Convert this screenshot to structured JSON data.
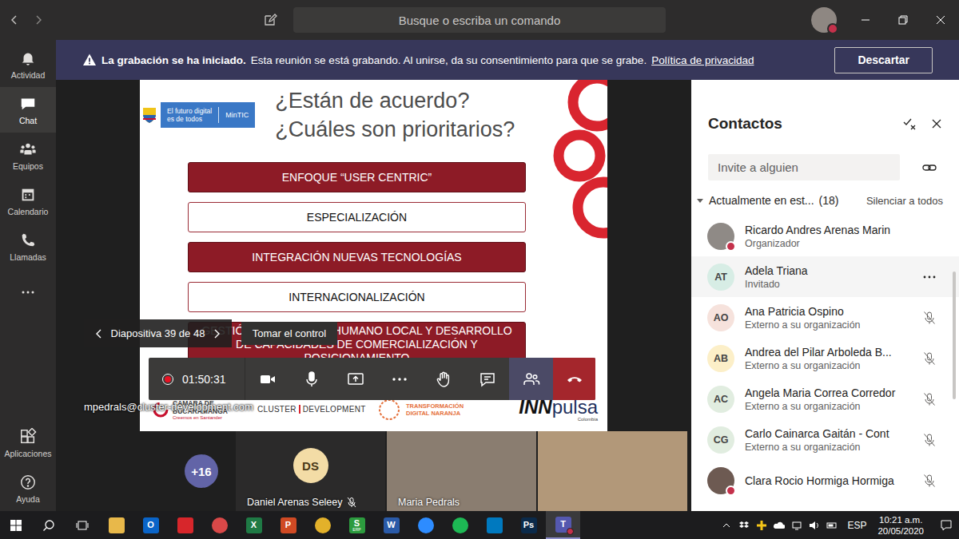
{
  "window": {
    "search_placeholder": "Busque o escriba un comando",
    "user_busy": true
  },
  "banner": {
    "title": "La grabación se ha iniciado.",
    "message": "Esta reunión se está grabando. Al unirse, da su consentimiento para que se grabe.",
    "link": "Política de privacidad",
    "button": "Descartar"
  },
  "rail": {
    "items": [
      {
        "label": "Actividad",
        "selected": false
      },
      {
        "label": "Chat",
        "selected": true
      },
      {
        "label": "Equipos",
        "selected": false
      },
      {
        "label": "Calendario",
        "selected": false
      },
      {
        "label": "Llamadas",
        "selected": false
      }
    ],
    "bottom_items": [
      {
        "label": "Aplicaciones",
        "selected": false
      },
      {
        "label": "Ayuda",
        "selected": false
      }
    ]
  },
  "slide": {
    "brand": {
      "line1": "El futuro digital",
      "line2": "es de todos",
      "name": "MinTIC"
    },
    "title_lines": [
      "¿Están de acuerdo?",
      "¿Cuáles son prioritarios?"
    ],
    "items": [
      {
        "text": "ENFOQUE “USER CENTRIC”",
        "kind": "filled"
      },
      {
        "text": "ESPECIALIZACIÓN",
        "kind": "outline"
      },
      {
        "text": "INTEGRACIÓN NUEVAS TECNOLOGÍAS",
        "kind": "filled"
      },
      {
        "text": "INTERNACIONALIZACIÓN",
        "kind": "outline"
      },
      {
        "text": "GESTIÓN DEL TALENTO HUMANO LOCAL Y DESARROLLO DE CAPACIDADES DE COMERCIALIZACIÓN Y POSICIONAMIENTO",
        "kind": "filled"
      }
    ],
    "footer": {
      "chamber_line1": "CAMARA DE",
      "chamber_line2": "BUCARAMANGA",
      "chamber_tagline": "Creemos en Santander",
      "cluster_left": "CLUSTER",
      "cluster_right": "DEVELOPMENT",
      "naranja_line1": "TRANSFORMACIÓN",
      "naranja_line2": "DIGITAL NARANJA",
      "inn": "INN",
      "pulsa": "pulsa",
      "inn_country": "Colombia"
    }
  },
  "presenter": {
    "email": "mpedrals@cluster-development.com",
    "slide_counter": "Diapositiva 39 de 48",
    "take_control": "Tomar el control"
  },
  "call_controls": {
    "recording": true,
    "timer": "01:50:31",
    "buttons": [
      {
        "kind": "camera",
        "selected": false
      },
      {
        "kind": "mic",
        "selected": false
      },
      {
        "kind": "share",
        "selected": false
      },
      {
        "kind": "more",
        "selected": false
      },
      {
        "kind": "hand",
        "selected": false
      },
      {
        "kind": "chat",
        "selected": false
      },
      {
        "kind": "participants",
        "selected": true
      },
      {
        "kind": "hangup",
        "selected": false
      }
    ]
  },
  "gallery": {
    "overflow": "+16",
    "tiles": [
      {
        "kind": "avatar",
        "initials": "DS",
        "name": "Daniel Arenas Seleey",
        "muted": true,
        "color": "#f3dca6"
      },
      {
        "kind": "video",
        "name": "Maria Pedrals",
        "muted": false,
        "color": "#8a7d70"
      },
      {
        "kind": "video",
        "muted": false,
        "color": "#b29879"
      }
    ]
  },
  "panel": {
    "title": "Contactos",
    "invite_placeholder": "Invite a alguien",
    "section": {
      "label": "Actualmente en est...",
      "count": "(18)",
      "expanded": true,
      "action": "Silenciar a todos"
    },
    "participants": [
      {
        "kind": "photo",
        "name": "Ricardo Andres Arenas Marin",
        "role": "Organizador",
        "busy": true,
        "muted": false,
        "hovered": false,
        "color": "#8f8a86"
      },
      {
        "kind": "initials",
        "initials": "AT",
        "name": "Adela Triana",
        "role": "Invitado",
        "busy": false,
        "muted": false,
        "hovered": true,
        "color": "#d7ede5"
      },
      {
        "kind": "initials",
        "initials": "AO",
        "name": "Ana Patricia Ospino",
        "role": "Externo a su organización",
        "busy": false,
        "muted": true,
        "hovered": false,
        "color": "#f6e2dc"
      },
      {
        "kind": "initials",
        "initials": "AB",
        "name": "Andrea del Pilar Arboleda B...",
        "role": "Externo a su organización",
        "busy": false,
        "muted": true,
        "hovered": false,
        "color": "#fcefc8"
      },
      {
        "kind": "initials",
        "initials": "AC",
        "name": "Angela Maria Correa Corredor",
        "role": "Externo a su organización",
        "busy": false,
        "muted": true,
        "hovered": false,
        "color": "#e1ede0"
      },
      {
        "kind": "initials",
        "initials": "CG",
        "name": "Carlo Cainarca Gaitán - Cont",
        "role": "Externo a su organización",
        "busy": false,
        "muted": true,
        "hovered": false,
        "color": "#e1ede0"
      },
      {
        "kind": "photo",
        "name": "Clara Rocio Hormiga Hormiga",
        "busy": true,
        "muted": true,
        "hovered": false,
        "color": "#6d5a52"
      }
    ]
  },
  "taskbar": {
    "apps": [
      {
        "kind": "square",
        "color": "#e8b84a",
        "active": false
      },
      {
        "kind": "square",
        "glyph": "O",
        "color": "#0a64c8",
        "active": false
      },
      {
        "kind": "square",
        "color": "#d7262b",
        "active": false
      },
      {
        "kind": "round",
        "color": "#d94848",
        "active": false
      },
      {
        "kind": "square",
        "glyph": "X",
        "color": "#1f7a45",
        "active": false
      },
      {
        "kind": "square",
        "glyph": "P",
        "color": "#d04a24",
        "active": false
      },
      {
        "kind": "round",
        "color": "#e3b12a",
        "active": false
      },
      {
        "kind": "square",
        "glyph": "S",
        "sub": "ERP",
        "color": "#2c9b3e",
        "active": false
      },
      {
        "kind": "square",
        "glyph": "W",
        "color": "#2a5aa8",
        "active": false
      },
      {
        "kind": "round",
        "color": "#2d8cff",
        "active": false
      },
      {
        "kind": "round",
        "color": "#1db954",
        "active": false
      },
      {
        "kind": "square",
        "color": "#0079bf",
        "active": false
      },
      {
        "kind": "square",
        "glyph": "Ps",
        "color": "#0b2a4a",
        "active": false
      },
      {
        "kind": "square",
        "glyph": "T",
        "color": "#5558af",
        "active": true,
        "busy": true
      }
    ],
    "language": "ESP",
    "time": "10:21 a.m.",
    "date": "20/05/2020"
  }
}
